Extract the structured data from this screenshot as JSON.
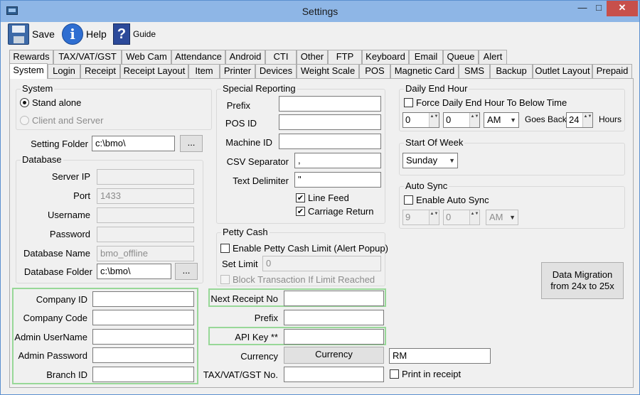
{
  "window": {
    "title": "Settings",
    "controls": {
      "minimize": "—",
      "maximize": "□",
      "close": "✕"
    }
  },
  "toolbar": {
    "save_label": "Save",
    "help_label": "Help",
    "guide_label": "Guide",
    "info_glyph": "i",
    "guide_glyph": "?"
  },
  "tabs_row1": [
    "Rewards",
    "TAX/VAT/GST",
    "Web Cam",
    "Attendance",
    "Android",
    "CTI",
    "Other",
    "FTP",
    "Keyboard",
    "Email",
    "Queue",
    "Alert"
  ],
  "tabs_row2": [
    "System",
    "Login",
    "Receipt",
    "Receipt Layout",
    "Item",
    "Printer",
    "Devices",
    "Weight Scale",
    "POS",
    "Magnetic Card",
    "SMS",
    "Backup",
    "Outlet Layout",
    "Prepaid"
  ],
  "active_tab": "System",
  "system_group": {
    "legend": "System",
    "stand_alone": "Stand alone",
    "client_server": "Client and Server"
  },
  "setting_folder": {
    "label": "Setting Folder",
    "value": "c:\\bmo\\",
    "browse": "..."
  },
  "database": {
    "legend": "Database",
    "server_ip_label": "Server IP",
    "server_ip": "",
    "port_label": "Port",
    "port": "1433",
    "username_label": "Username",
    "username": "",
    "password_label": "Password",
    "password": "",
    "dbname_label": "Database Name",
    "dbname": "bmo_offline",
    "folder_label": "Database Folder",
    "folder": "c:\\bmo\\",
    "browse": "..."
  },
  "company": {
    "company_id_label": "Company ID",
    "company_id": "",
    "company_code_label": "Company Code",
    "company_code": "",
    "admin_user_label": "Admin UserName",
    "admin_user": "",
    "admin_pass_label": "Admin Password",
    "admin_pass": "",
    "branch_label": "Branch ID",
    "branch": ""
  },
  "special_reporting": {
    "legend": "Special Reporting",
    "prefix_label": "Prefix",
    "prefix": "",
    "pos_id_label": "POS ID",
    "pos_id": "",
    "machine_id_label": "Machine ID",
    "machine_id": "",
    "csv_sep_label": "CSV Separator",
    "csv_sep": ",",
    "text_delim_label": "Text Delimiter",
    "text_delim": "\"",
    "line_feed_label": "Line Feed",
    "carriage_return_label": "Carriage Return",
    "check_mark": "✔"
  },
  "petty_cash": {
    "legend": "Petty Cash",
    "enable_label": "Enable Petty Cash Limit (Alert Popup)",
    "set_limit_label": "Set Limit",
    "set_limit": "0",
    "block_label": "Block Transaction If Limit Reached"
  },
  "receipt": {
    "next_no_label": "Next Receipt No",
    "next_no": "",
    "prefix_label": "Prefix",
    "prefix": "",
    "api_key_label": "API Key **",
    "api_key": "",
    "currency_label": "Currency",
    "currency_button": "Currency",
    "currency_value": "RM",
    "tax_label": "TAX/VAT/GST No.",
    "tax": "",
    "print_label": "Print in receipt"
  },
  "daily_end": {
    "legend": "Daily End Hour",
    "force_label": "Force Daily End Hour To Below Time",
    "hour": "0",
    "minute": "0",
    "ampm": "AM",
    "goes_back_label": "Goes Back",
    "hours_value": "24",
    "hours_label": "Hours"
  },
  "start_of_week": {
    "legend": "Start Of Week",
    "value": "Sunday"
  },
  "auto_sync": {
    "legend": "Auto Sync",
    "enable_label": "Enable Auto Sync",
    "hour": "9",
    "minute": "0",
    "ampm": "AM"
  },
  "migration": {
    "line1": "Data Migration",
    "line2": "from 24x to 25x"
  },
  "glyphs": {
    "dropdown": "▼",
    "spin": "▲▼"
  }
}
